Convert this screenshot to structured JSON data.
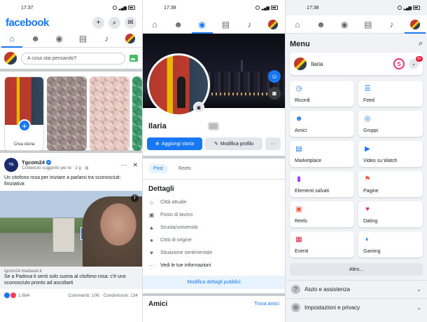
{
  "status": {
    "p1_time": "17:37",
    "p2_time": "17:38",
    "p3_time": "17:38"
  },
  "feed": {
    "logo": "facebook",
    "composer_placeholder": "A cosa stai pensando?",
    "create_story": "Crea storia",
    "post": {
      "author": "Tgcom24",
      "subtitle": "Contenuto suggerito per te · 2 g · ",
      "text": "Un citofono rosa per iniziare a parlarsi tra sconosciuti: finiziativa",
      "image_number": "5",
      "link_domain": "tgcom24.mediaset.it",
      "link_title": "Se a Padova ti senti solo suona al citofono rosa: c'è uno sconosciuto pronto ad ascoltarti",
      "reactions": "1.684",
      "comments": "Commenti: 106",
      "shares": "Condivisioni: 134"
    }
  },
  "profile": {
    "name": "Ilaria",
    "add_story": "Aggiungi storia",
    "edit_profile": "Modifica profilo",
    "more": "···",
    "tab_posts": "Post",
    "tab_reels": "Reels",
    "details_title": "Dettagli",
    "details": [
      "Città attuale",
      "Posto di lavoro",
      "Scuola/università",
      "Città di origine",
      "Situazione sentimentale"
    ],
    "see_info": "Vedi le tue informazioni",
    "edit_details": "Modifica dettagli pubblici",
    "friends": "Amici",
    "find_friends": "Trova amici"
  },
  "menu": {
    "title": "Menu",
    "user": "Ilaria",
    "badge_count": "9+",
    "tiles": [
      {
        "label": "Ricordi",
        "icon": "clock-icon",
        "color": "#1877f2"
      },
      {
        "label": "Feed",
        "icon": "feed-icon",
        "color": "#1877f2"
      },
      {
        "label": "Amici",
        "icon": "friends-icon",
        "color": "#1877f2"
      },
      {
        "label": "Gruppi",
        "icon": "groups-icon",
        "color": "#1877f2"
      },
      {
        "label": "Marketplace",
        "icon": "store-icon",
        "color": "#1877f2"
      },
      {
        "label": "Video su Watch",
        "icon": "video-icon",
        "color": "#1877f2"
      },
      {
        "label": "Elementi salvati",
        "icon": "bookmark-icon",
        "color": "#a033ff"
      },
      {
        "label": "Pagine",
        "icon": "flag-icon",
        "color": "#f7533e"
      },
      {
        "label": "Reels",
        "icon": "reels-icon",
        "color": "#f7533e"
      },
      {
        "label": "Dating",
        "icon": "heart-icon",
        "color": "#e4307d"
      },
      {
        "label": "Eventi",
        "icon": "calendar-icon",
        "color": "#e41e3f"
      },
      {
        "label": "Gaming",
        "icon": "gamepad-icon",
        "color": "#1877f2"
      }
    ],
    "more": "Altro...",
    "help": "Aiuto e assistenza",
    "settings": "Impostazioni e privacy"
  }
}
